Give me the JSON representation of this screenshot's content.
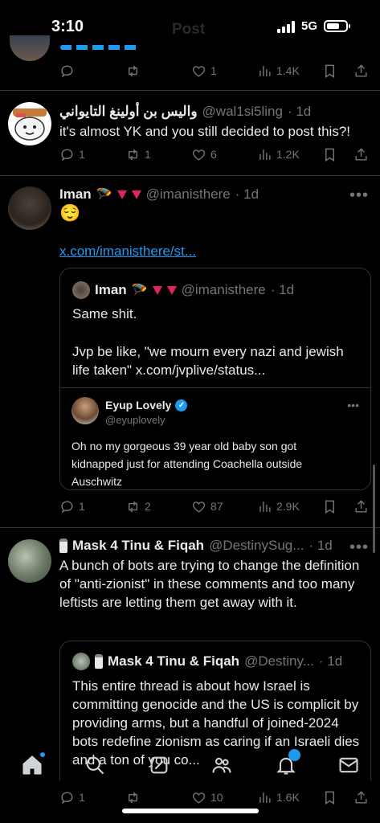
{
  "status": {
    "time": "3:10",
    "ghost_title": "Post",
    "network": "5G"
  },
  "top_post": {
    "reply": "",
    "retweet": "",
    "like": "1",
    "views": "1.4K"
  },
  "post1": {
    "display_name": "واليس بن أولينغ التايواني",
    "handle": "@wal1si5ling",
    "time": "· 1d",
    "text": "it's almost YK and you still decided to post this?!",
    "reply": "1",
    "retweet": "1",
    "like": "6",
    "views": "1.2K"
  },
  "post2": {
    "display_name": "Iman",
    "emojis": "🪂",
    "handle": "@imanisthere",
    "time": "· 1d",
    "text": "😌",
    "link": "x.com/imanisthere/st...",
    "quote": {
      "display_name": "Iman",
      "handle": "@imanisthere",
      "time": "· 1d",
      "line1": "Same shit.",
      "line2": "Jvp be like, \"we mourn every nazi and jewish life taken\" x.com/jvplive/status...",
      "embed": {
        "name": "Eyup Lovely",
        "handle": "@eyuplovely",
        "text": "Oh no my gorgeous 39 year old baby son got kidnapped just for attending Coachella outside Auschwitz"
      }
    },
    "reply": "1",
    "retweet": "2",
    "like": "87",
    "views": "2.9K"
  },
  "post3": {
    "display_name": "Mask 4 Tinu & Fiqah",
    "handle": "@DestinySug...",
    "time": "· 1d",
    "text": "A bunch of bots are trying to change the definition of \"anti-zionist\" in these comments and too many leftists are letting them get away with it.",
    "quote": {
      "display_name": "Mask 4 Tinu & Fiqah",
      "handle": "@Destiny...",
      "time": "· 1d",
      "text": "This entire thread is about how Israel is committing genocide and the US is complicit by providing arms, but a handful of joined-2024 bots redefine zionism as caring if an Israeli dies and a ton of you co..."
    },
    "reply": "1",
    "retweet": "",
    "like": "10",
    "views": "1.6K"
  },
  "tabs": [
    "home-icon",
    "search-icon",
    "grok-icon",
    "communities-icon",
    "notifications-icon",
    "messages-icon"
  ]
}
